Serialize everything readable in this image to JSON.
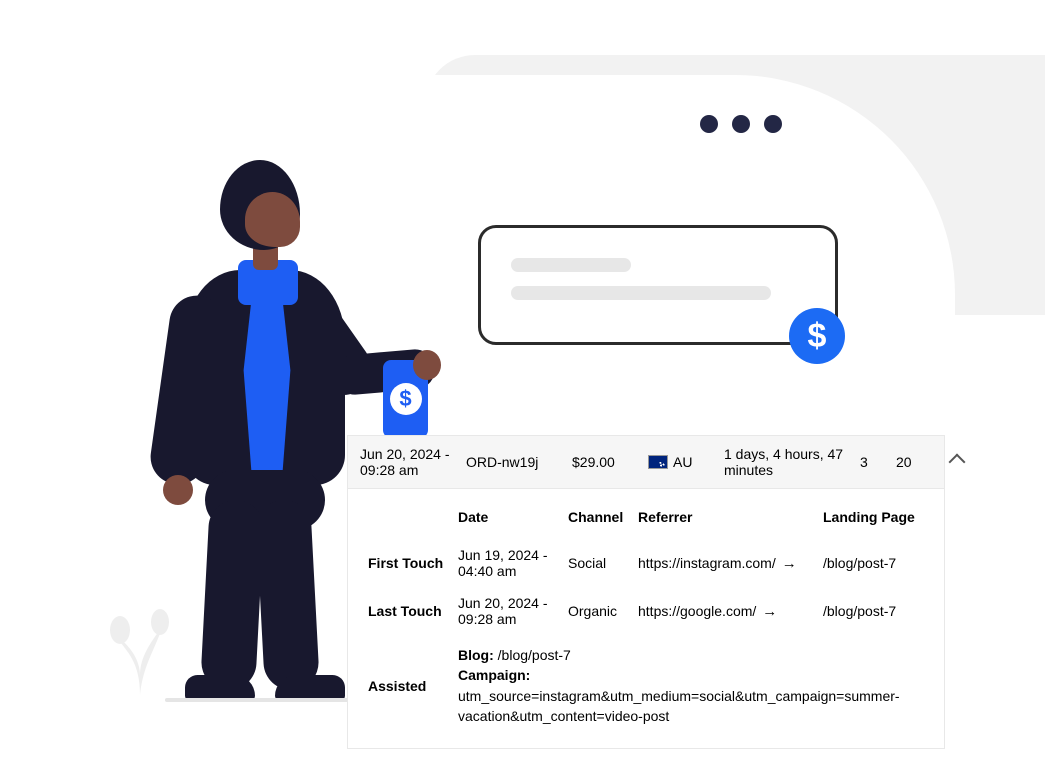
{
  "summary": {
    "date": "Jun 20, 2024 - 09:28 am",
    "order": "ORD-nw19j",
    "amount": "$29.00",
    "country_code": "AU",
    "duration": "1 days, 4 hours, 47 minutes",
    "count_a": "3",
    "count_b": "20"
  },
  "columns": {
    "date": "Date",
    "channel": "Channel",
    "referrer": "Referrer",
    "landing": "Landing Page"
  },
  "rows": {
    "first": {
      "label": "First Touch",
      "date": "Jun 19, 2024 - 04:40 am",
      "channel": "Social",
      "referrer": "https://instagram.com/",
      "landing": "/blog/post-7"
    },
    "last": {
      "label": "Last Touch",
      "date": "Jun 20, 2024 - 09:28 am",
      "channel": "Organic",
      "referrer": "https://google.com/",
      "landing": "/blog/post-7"
    }
  },
  "assisted": {
    "label": "Assisted",
    "blog_label": "Blog:",
    "blog_value": "/blog/post-7",
    "campaign_label": "Campaign:",
    "campaign_value": "utm_source=instagram&utm_medium=social&utm_campaign=summer-vacation&utm_content=video-post"
  },
  "glyphs": {
    "dollar": "$",
    "arrow": "→"
  }
}
